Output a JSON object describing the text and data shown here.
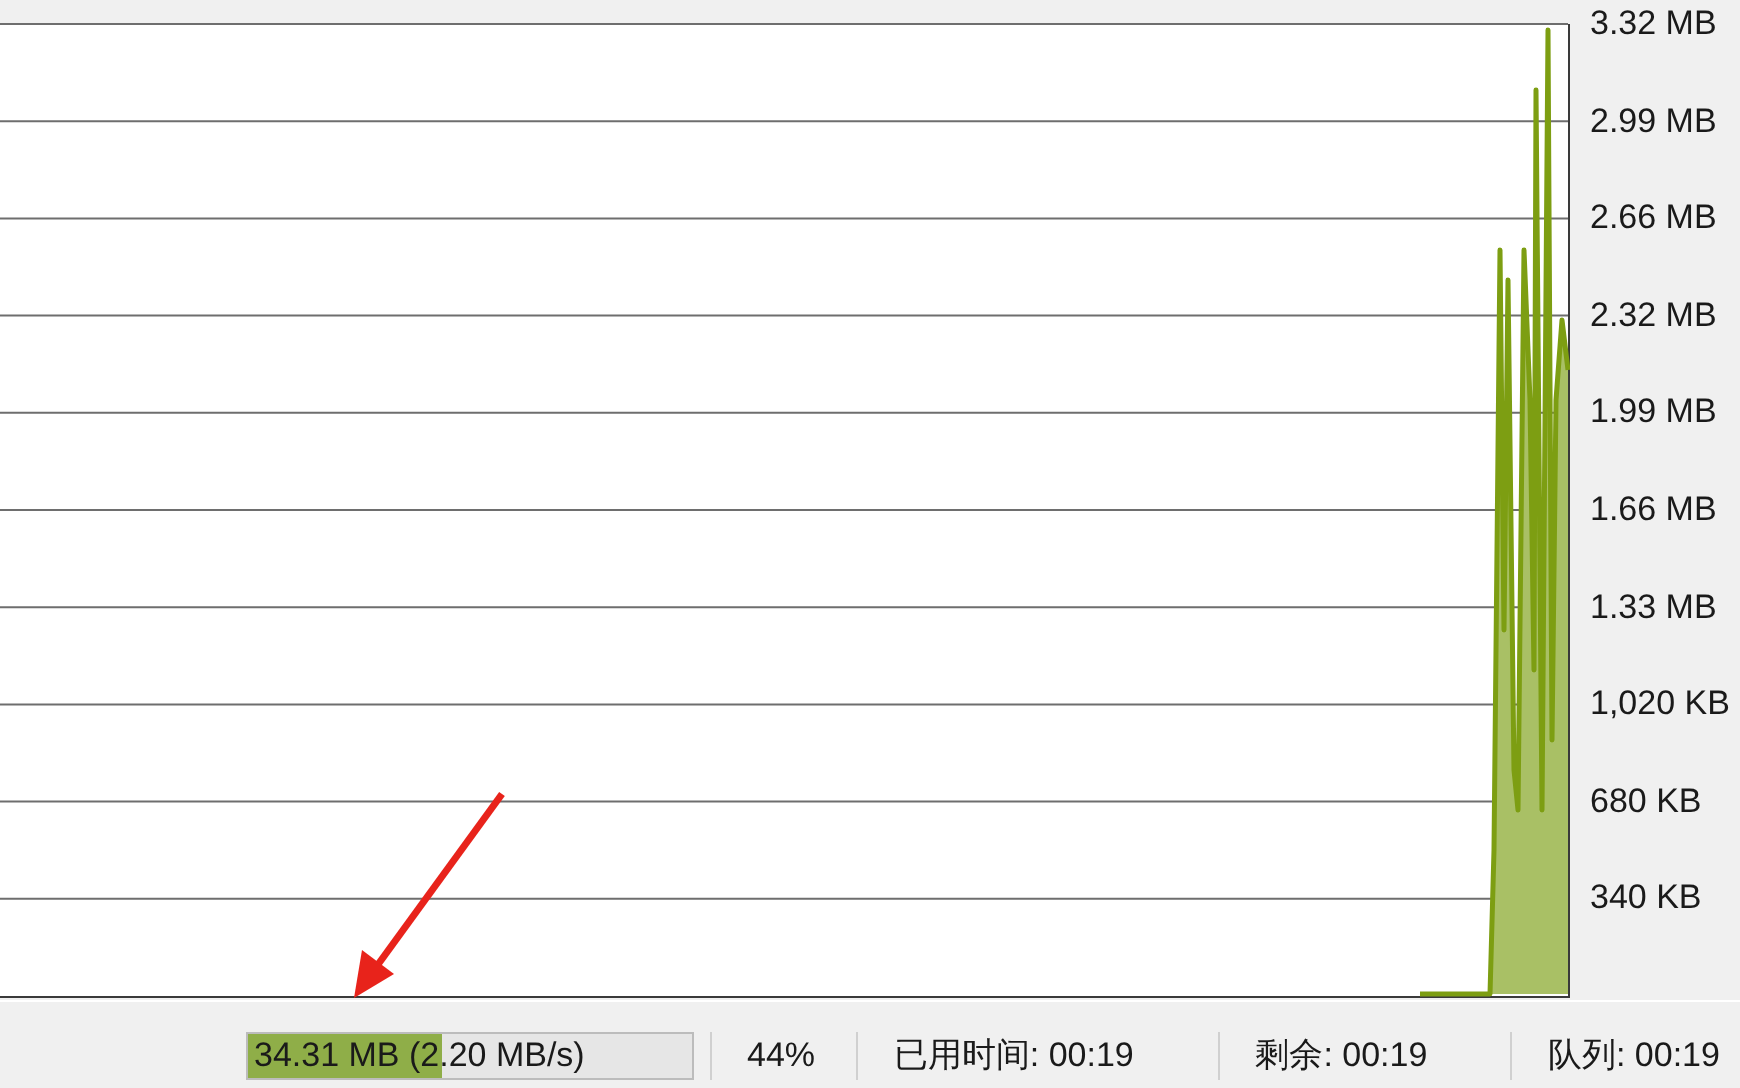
{
  "y_axis_labels": [
    "3.32 MB",
    "2.99 MB",
    "2.66 MB",
    "2.32 MB",
    "1.99 MB",
    "1.66 MB",
    "1.33 MB",
    "1,020 KB",
    "680 KB",
    "340 KB"
  ],
  "status_bar": {
    "transferred": {
      "text": "34.31 MB (2.20 MB/s)",
      "level": 0.44
    },
    "percent": "44%",
    "elapsed": "已用时间: 00:19",
    "remaining": "剩余: 00:19",
    "queue": "队列: 00:19"
  }
}
